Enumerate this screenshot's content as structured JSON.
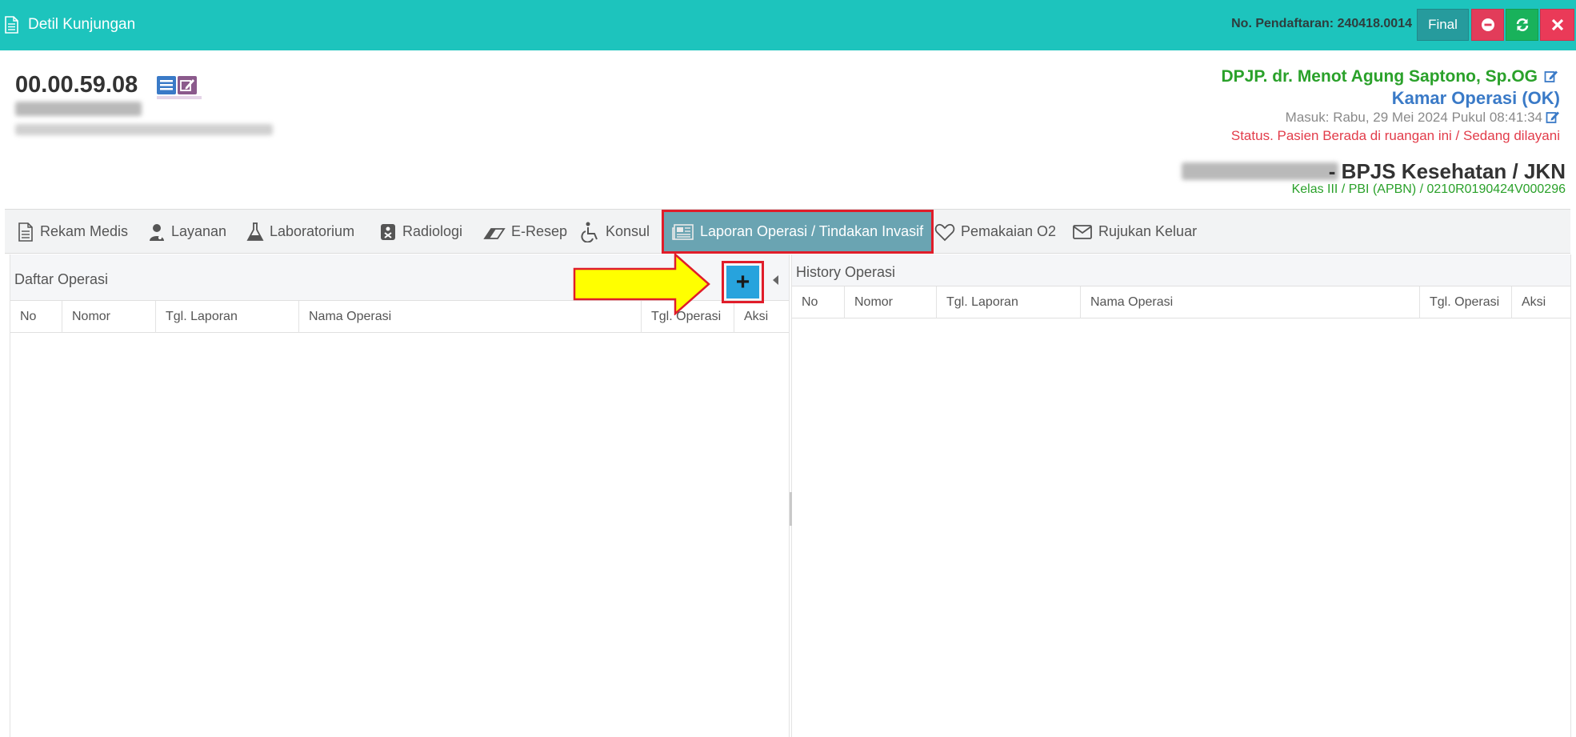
{
  "titlebar": {
    "title": "Detil Kunjungan",
    "registration": "No. Pendaftaran: 240418.0014",
    "final_label": "Final",
    "icons": {
      "doc": "document-icon",
      "minimize": "minus-circle-icon",
      "refresh": "refresh-icon",
      "close": "close-icon"
    }
  },
  "patient": {
    "rm_number": "00.00.59.08",
    "dpjp": "DPJP. dr. Menot Agung Saptono, Sp.OG",
    "ruang": "Kamar Operasi (OK)",
    "masuk": "Masuk: Rabu, 29 Mei 2024 Pukul 08:41:34",
    "status": "Status. Pasien Berada di ruangan ini / Sedang dilayani",
    "jaminan": "- BPJS Kesehatan / JKN",
    "kelas": "Kelas III / PBI (APBN) / 0210R0190424V000296"
  },
  "tabs": [
    {
      "label": "Rekam Medis",
      "icon": "document-icon"
    },
    {
      "label": "Layanan",
      "icon": "doctor-icon"
    },
    {
      "label": "Laboratorium",
      "icon": "flask-icon"
    },
    {
      "label": "Radiologi",
      "icon": "radiology-icon"
    },
    {
      "label": "E-Resep",
      "icon": "eraser-icon"
    },
    {
      "label": "Konsul",
      "icon": "wheelchair-icon"
    },
    {
      "label": "Laporan Operasi / Tindakan Invasif",
      "icon": "newspaper-icon"
    },
    {
      "label": "Pemakaian O2",
      "icon": "heart-icon"
    },
    {
      "label": "Rujukan Keluar",
      "icon": "envelope-icon"
    }
  ],
  "left_panel": {
    "title": "Daftar Operasi",
    "add_label": "+",
    "columns": [
      "No",
      "Nomor",
      "Tgl. Laporan",
      "Nama Operasi",
      "Tgl. Operasi",
      "Aksi"
    ]
  },
  "right_panel": {
    "title": "History Operasi",
    "columns": [
      "No",
      "Nomor",
      "Tgl. Laporan",
      "Nama Operasi",
      "Tgl. Operasi",
      "Aksi"
    ]
  },
  "colors": {
    "titlebar": "#1dc4bd",
    "final": "#269b9d",
    "danger": "#e23c5a",
    "success": "#19b25b",
    "active_tab": "#6aa4b2",
    "highlight": "#e01d2a",
    "arrow": "#ffff00"
  }
}
